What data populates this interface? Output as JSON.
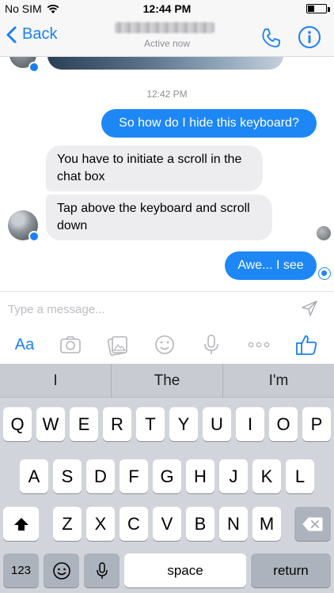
{
  "status_bar": {
    "carrier": "No SIM",
    "time": "12:44 PM"
  },
  "nav": {
    "back_label": "Back",
    "status": "Active now"
  },
  "chat": {
    "timestamp": "12:42 PM",
    "messages": [
      {
        "from": "me",
        "text": "So how do I hide this keyboard?"
      },
      {
        "from": "them",
        "text": "You have to initiate a scroll in the chat box"
      },
      {
        "from": "them",
        "text": "Tap above the keyboard and scroll down"
      },
      {
        "from": "me",
        "text": "Awe... I see"
      }
    ]
  },
  "composer": {
    "placeholder": "Type a message...",
    "text_style_label": "Aa",
    "tools": [
      "camera-icon",
      "gallery-icon",
      "sticker-icon",
      "microphone-icon",
      "more-icon",
      "like-icon"
    ]
  },
  "keyboard": {
    "suggestions": [
      "I",
      "The",
      "I'm"
    ],
    "row1": [
      "Q",
      "W",
      "E",
      "R",
      "T",
      "Y",
      "U",
      "I",
      "O",
      "P"
    ],
    "row2": [
      "A",
      "S",
      "D",
      "F",
      "G",
      "H",
      "J",
      "K",
      "L"
    ],
    "row3": [
      "Z",
      "X",
      "C",
      "V",
      "B",
      "N",
      "M"
    ],
    "numbers_label": "123",
    "space_label": "space",
    "return_label": "return"
  },
  "colors": {
    "accent": "#1a7ff3",
    "outgoing_bubble": "#1d87f6",
    "incoming_bubble": "#ededf0",
    "keyboard_bg": "#d1d5db"
  }
}
